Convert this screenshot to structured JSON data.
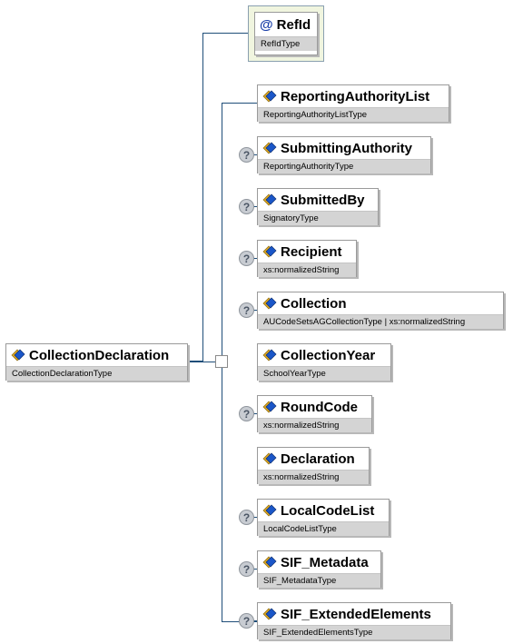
{
  "root": {
    "name": "CollectionDeclaration",
    "type": "CollectionDeclarationType",
    "icon": "element-icon"
  },
  "attribute": {
    "name": "RefId",
    "type": "RefIdType",
    "icon": "at-icon",
    "icon_glyph": "@"
  },
  "optional_marker": "?",
  "children": [
    {
      "name": "ReportingAuthorityList",
      "type": "ReportingAuthorityListType",
      "optional": false
    },
    {
      "name": "SubmittingAuthority",
      "type": "ReportingAuthorityType",
      "optional": true
    },
    {
      "name": "SubmittedBy",
      "type": "SignatoryType",
      "optional": true
    },
    {
      "name": "Recipient",
      "type": "xs:normalizedString",
      "optional": true
    },
    {
      "name": "Collection",
      "type": "AUCodeSetsAGCollectionType | xs:normalizedString",
      "optional": true
    },
    {
      "name": "CollectionYear",
      "type": "SchoolYearType",
      "optional": false
    },
    {
      "name": "RoundCode",
      "type": "xs:normalizedString",
      "optional": true
    },
    {
      "name": "Declaration",
      "type": "xs:normalizedString",
      "optional": false
    },
    {
      "name": "LocalCodeList",
      "type": "LocalCodeListType",
      "optional": true
    },
    {
      "name": "SIF_Metadata",
      "type": "SIF_MetadataType",
      "optional": true
    },
    {
      "name": "SIF_ExtendedElements",
      "type": "SIF_ExtendedElementsType",
      "optional": true
    }
  ],
  "colors": {
    "connector": "#1f4e79",
    "icon_blue": "#1a56c8",
    "icon_gold": "#e0a820"
  }
}
